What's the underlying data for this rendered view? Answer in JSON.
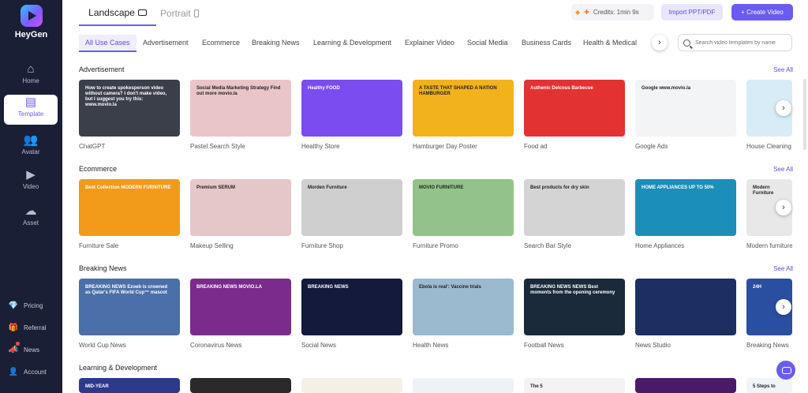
{
  "app": {
    "logo_text": "HeyGen"
  },
  "sidebar": {
    "items": [
      {
        "label": "Home",
        "icon": "home-icon",
        "glyph": "⌂"
      },
      {
        "label": "Template",
        "icon": "template-icon",
        "glyph": "▤"
      },
      {
        "label": "Avatar",
        "icon": "avatar-icon",
        "glyph": "👥"
      },
      {
        "label": "Video",
        "icon": "video-icon",
        "glyph": "▶"
      },
      {
        "label": "Asset",
        "icon": "asset-icon",
        "glyph": "☁"
      }
    ],
    "bottom": [
      {
        "label": "Pricing",
        "icon": "diamond-icon",
        "glyph": "💎"
      },
      {
        "label": "Referral",
        "icon": "gift-icon",
        "glyph": "🎁"
      },
      {
        "label": "News",
        "icon": "news-icon",
        "glyph": "📣"
      },
      {
        "label": "Account",
        "icon": "account-icon",
        "glyph": "👤"
      }
    ]
  },
  "header": {
    "tabs": [
      "Landscape",
      "Portrait"
    ],
    "credits": "Credits: 1min 9s",
    "import_label": "Import PPT/PDF",
    "create_label": "+ Create Video"
  },
  "categories": [
    "All Use Cases",
    "Advertisement",
    "Ecommerce",
    "Breaking News",
    "Learning & Development",
    "Explainer Video",
    "Social Media",
    "Business Cards",
    "Health & Medical"
  ],
  "search": {
    "placeholder": "Search video templates by name"
  },
  "see_all": "See All",
  "sections": [
    {
      "title": "Advertisement",
      "cards": [
        {
          "label": "ChatGPT",
          "bg": "#3a3f4a",
          "overlay": "How to create spokesperson video without camera?  I don't make video, but I suggest you try this: www.movio.la"
        },
        {
          "label": "Pastel Search Style",
          "bg": "#eac5c8",
          "overlay": "Social Media Marketing Strategy  Find out more movio.la"
        },
        {
          "label": "Healthy Store",
          "bg": "#7b4cf0",
          "overlay": "Healthy FOOD"
        },
        {
          "label": "Hamburger Day Poster",
          "bg": "#f2b21b",
          "overlay": "A TASTE THAT SHAPED A NATION  HAMBURGER"
        },
        {
          "label": "Food ad",
          "bg": "#e23232",
          "overlay": "Authenic Delcous Barbecue"
        },
        {
          "label": "Google Ads",
          "bg": "#f3f4f6",
          "overlay": "Google  www.movio.la"
        },
        {
          "label": "House Cleaning",
          "bg": "#d7ecf7",
          "overlay": ""
        }
      ]
    },
    {
      "title": "Ecommerce",
      "cards": [
        {
          "label": "Furniture Sale",
          "bg": "#f29a1a",
          "overlay": "Best Collection  MODERN FURNITURE"
        },
        {
          "label": "Makeup Selling",
          "bg": "#e6c7c9",
          "overlay": "Premium SERUM"
        },
        {
          "label": "Furniture Shop",
          "bg": "#cfcfcf",
          "overlay": "Morden Furniture"
        },
        {
          "label": "Furniture Promo",
          "bg": "#93c28a",
          "overlay": "MOVIO FURNITURE"
        },
        {
          "label": "Search Bar Style",
          "bg": "#d4d4d4",
          "overlay": "Best products for dry skin"
        },
        {
          "label": "Home Appliances",
          "bg": "#1c8fb8",
          "overlay": "HOME APPLIANCES  UP TO 50%"
        },
        {
          "label": "Modern furniture",
          "bg": "#e8e8e8",
          "overlay": "Modern Furniture"
        }
      ]
    },
    {
      "title": "Breaking News",
      "cards": [
        {
          "label": "World Cup News",
          "bg": "#4b6fa8",
          "overlay": "BREAKING NEWS  Ezoeb is crowned as Qatar's FIFA World Cup™ mascot"
        },
        {
          "label": "Coronavirus News",
          "bg": "#7a2b8c",
          "overlay": "BREAKING NEWS  MOVIO.LA"
        },
        {
          "label": "Social News",
          "bg": "#141a3c",
          "overlay": "BREAKING NEWS"
        },
        {
          "label": "Health News",
          "bg": "#9bb9cf",
          "overlay": "Ebola is real': Vaccine trials"
        },
        {
          "label": "Football News",
          "bg": "#1a2a3a",
          "overlay": "BREAKING NEWS  NEWS  Best moments from the opening ceremony"
        },
        {
          "label": "News Studio",
          "bg": "#1d2f62",
          "overlay": ""
        },
        {
          "label": "Breaking News",
          "bg": "#2a4ea0",
          "overlay": "24H"
        }
      ]
    },
    {
      "title": "Learning & Development",
      "cards": [
        {
          "label": "",
          "bg": "#2d3a8c",
          "overlay": "MID-YEAR"
        },
        {
          "label": "",
          "bg": "#2a2a2a",
          "overlay": ""
        },
        {
          "label": "",
          "bg": "#f5f0e6",
          "overlay": ""
        },
        {
          "label": "",
          "bg": "#eef2f6",
          "overlay": ""
        },
        {
          "label": "",
          "bg": "#f3f3f3",
          "overlay": "The 5"
        },
        {
          "label": "",
          "bg": "#4a1a6a",
          "overlay": ""
        },
        {
          "label": "",
          "bg": "#f0f5fa",
          "overlay": "5 Steps to"
        }
      ]
    }
  ]
}
